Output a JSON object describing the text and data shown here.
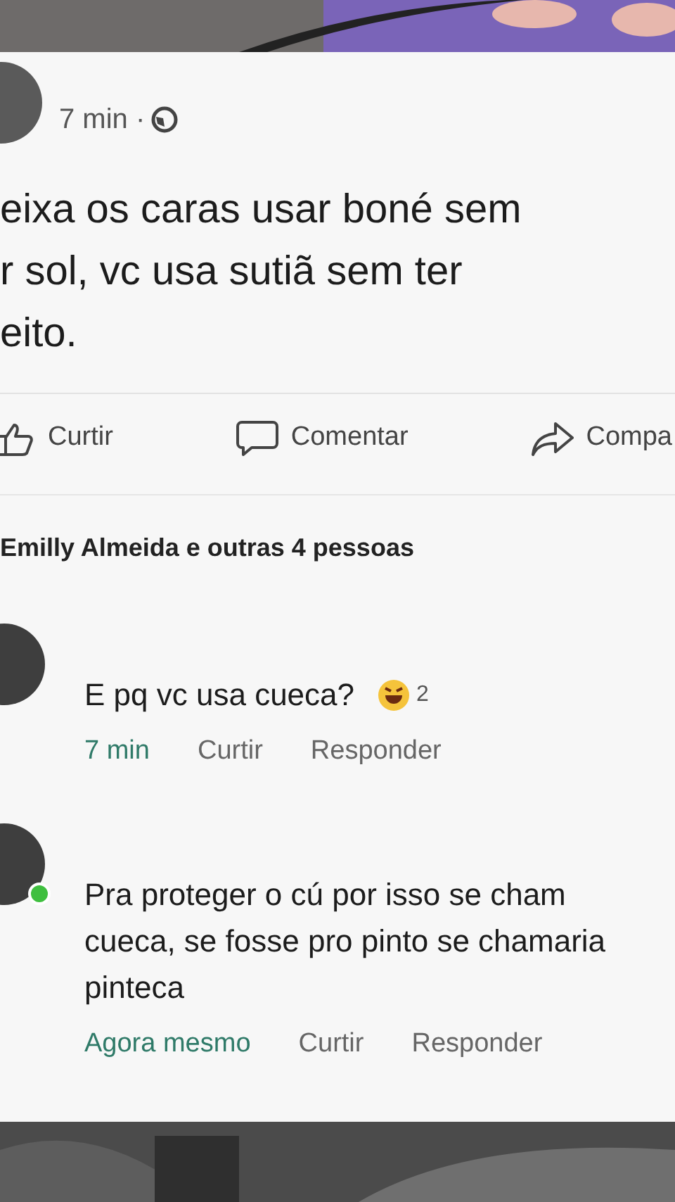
{
  "post": {
    "time": "7 min ·",
    "lines": [
      "eixa os caras usar boné sem",
      "r sol, vc usa sutiã sem ter",
      "eito."
    ]
  },
  "actions": [
    {
      "kind": "like",
      "label": "Curtir"
    },
    {
      "kind": "comment",
      "label": "Comentar"
    },
    {
      "kind": "share",
      "label": "Compa"
    }
  ],
  "reactions_summary": "Emilly Almeida e outras 4 pessoas",
  "comments": [
    {
      "text": "E pq vc usa cueca?",
      "reaction_count": "2",
      "online": false,
      "time": "7 min",
      "like": "Curtir",
      "reply": "Responder"
    },
    {
      "text": "Pra proteger o cú por isso se cham cueca, se fosse pro pinto se chamaria pinteca",
      "online": true,
      "time": "Agora mesmo",
      "like": "Curtir",
      "reply": "Responder"
    }
  ]
}
